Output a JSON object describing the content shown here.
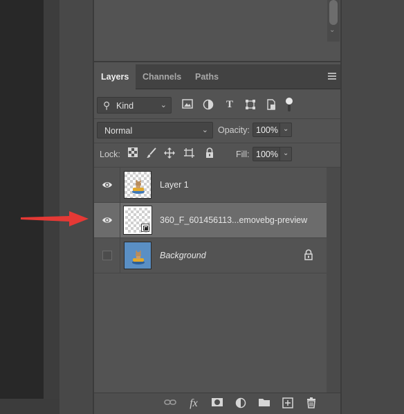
{
  "tabs": [
    {
      "label": "Layers",
      "active": true
    },
    {
      "label": "Channels",
      "active": false
    },
    {
      "label": "Paths",
      "active": false
    }
  ],
  "filter": {
    "kind_label": "Kind",
    "icons": [
      "image-filter-icon",
      "adjustment-filter-icon",
      "type-filter-icon",
      "shape-filter-icon",
      "smart-object-filter-icon",
      "filter-toggle"
    ]
  },
  "blend": {
    "mode": "Normal",
    "opacity_label": "Opacity:",
    "opacity_value": "100%"
  },
  "lock": {
    "label": "Lock:",
    "fill_label": "Fill:",
    "fill_value": "100%"
  },
  "layers": [
    {
      "name": "Layer 1",
      "visible": true,
      "selected": false,
      "italic": false,
      "locked": false,
      "thumb": "transparent-with-art"
    },
    {
      "name": "360_F_601456113...emovebg-preview",
      "visible": true,
      "selected": true,
      "italic": false,
      "locked": false,
      "thumb": "smart-object"
    },
    {
      "name": "Background",
      "visible": false,
      "selected": false,
      "italic": true,
      "locked": true,
      "thumb": "blue-background-art"
    }
  ],
  "bottom_bar": {
    "icons": [
      "link-layers-icon",
      "fx-icon",
      "add-mask-icon",
      "adjustment-layer-icon",
      "new-group-icon",
      "new-layer-icon",
      "delete-layer-icon"
    ],
    "fx_label": "fx"
  },
  "colors": {
    "panel_bg": "#535353",
    "selected_row": "#6c6c6c",
    "annotation_arrow": "#e53935"
  }
}
